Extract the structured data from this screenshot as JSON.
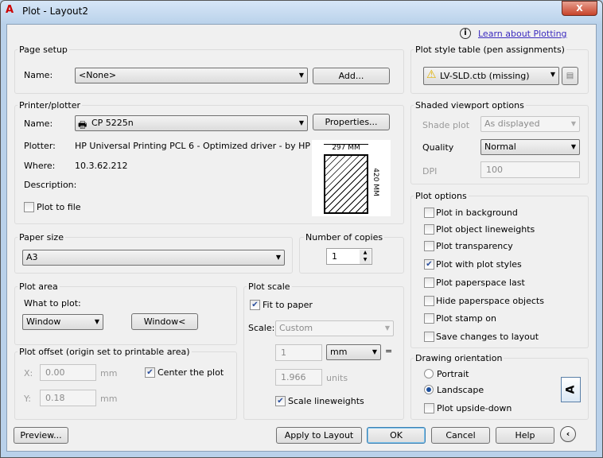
{
  "window": {
    "title": "Plot - Layout2",
    "close": "X"
  },
  "help_link": "Learn about Plotting",
  "page_setup": {
    "legend": "Page setup",
    "name_label": "Name:",
    "name_value": "<None>",
    "add_button": "Add..."
  },
  "printer": {
    "legend": "Printer/plotter",
    "name_label": "Name:",
    "name_value": "CP 5225n",
    "properties_button": "Properties...",
    "plotter_label": "Plotter:",
    "plotter_value": "HP Universal Printing PCL 6 - Optimized driver - by HP",
    "where_label": "Where:",
    "where_value": "10.3.62.212",
    "description_label": "Description:",
    "plot_to_file": "Plot to file",
    "preview_width": "297 MM",
    "preview_height": "420 MM"
  },
  "paper_size": {
    "legend": "Paper size",
    "value": "A3"
  },
  "copies": {
    "legend": "Number of copies",
    "value": "1"
  },
  "plot_area": {
    "legend": "Plot area",
    "what_label": "What to plot:",
    "what_value": "Window",
    "window_button": "Window<"
  },
  "plot_offset": {
    "legend": "Plot offset (origin set to printable area)",
    "x_label": "X:",
    "x_value": "0.00",
    "y_label": "Y:",
    "y_value": "0.18",
    "unit": "mm",
    "center": "Center the plot",
    "center_checked": true
  },
  "plot_scale": {
    "legend": "Plot scale",
    "fit": "Fit to paper",
    "fit_checked": true,
    "scale_label": "Scale:",
    "scale_value": "Custom",
    "value1": "1",
    "unit_value": "mm",
    "equals": "=",
    "value2": "1.966",
    "units_label": "units",
    "lineweights": "Scale lineweights",
    "lineweights_checked": true
  },
  "plot_style": {
    "legend": "Plot style table (pen assignments)",
    "value": "LV-SLD.ctb (missing)"
  },
  "shaded": {
    "legend": "Shaded viewport options",
    "shade_label": "Shade plot",
    "shade_value": "As displayed",
    "quality_label": "Quality",
    "quality_value": "Normal",
    "dpi_label": "DPI",
    "dpi_value": "100"
  },
  "plot_options": {
    "legend": "Plot options",
    "items": [
      {
        "label": "Plot in background",
        "checked": false
      },
      {
        "label": "Plot object lineweights",
        "checked": false
      },
      {
        "label": "Plot transparency",
        "checked": false
      },
      {
        "label": "Plot with plot styles",
        "checked": true
      },
      {
        "label": "Plot paperspace last",
        "checked": false
      },
      {
        "label": "Hide paperspace objects",
        "checked": false
      },
      {
        "label": "Plot stamp on",
        "checked": false
      },
      {
        "label": "Save changes to layout",
        "checked": false
      }
    ]
  },
  "orientation": {
    "legend": "Drawing orientation",
    "portrait": "Portrait",
    "landscape": "Landscape",
    "upside_down": "Plot upside-down",
    "selected": "Landscape",
    "icon_letter": "A"
  },
  "buttons": {
    "preview": "Preview...",
    "apply": "Apply to Layout",
    "ok": "OK",
    "cancel": "Cancel",
    "help": "Help"
  }
}
